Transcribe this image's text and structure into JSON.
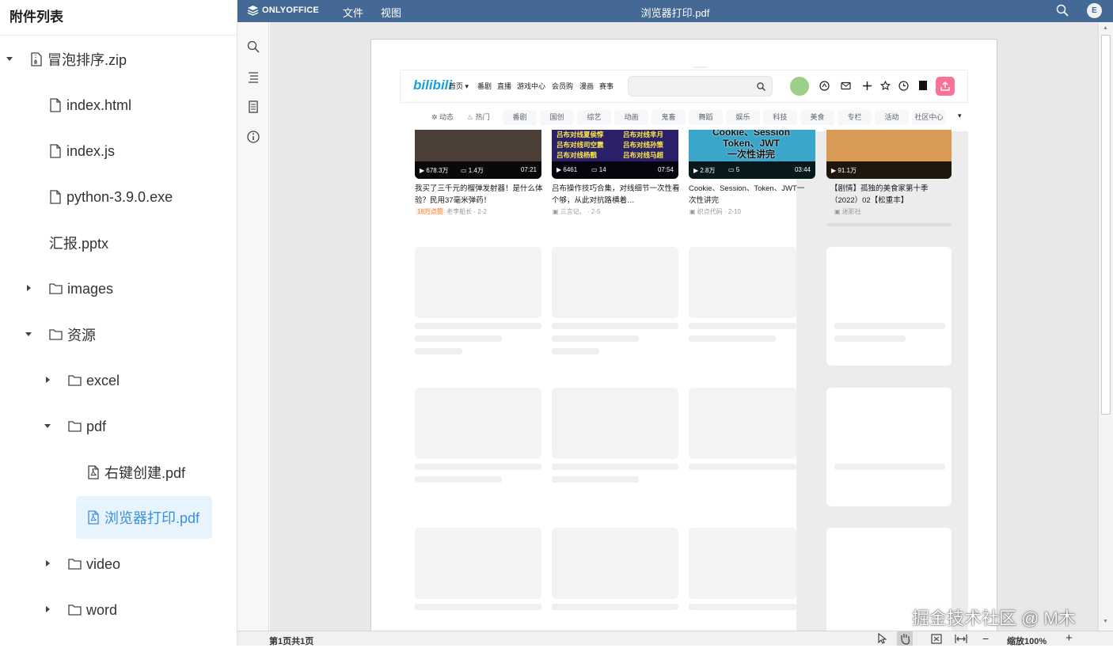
{
  "sidebar": {
    "title": "附件列表",
    "items": [
      {
        "label": "冒泡排序.zip"
      },
      {
        "label": "index.html"
      },
      {
        "label": "index.js"
      },
      {
        "label": "python-3.9.0.exe"
      },
      {
        "label": "汇报.pptx"
      },
      {
        "label": "images"
      },
      {
        "label": "资源"
      },
      {
        "label": "excel"
      },
      {
        "label": "pdf"
      },
      {
        "label": "右键创建.pdf"
      },
      {
        "label": "浏览器打印.pdf"
      },
      {
        "label": "video"
      },
      {
        "label": "word"
      }
    ]
  },
  "editor": {
    "brand": "ONLYOFFICE",
    "menu": [
      "文件",
      "视图"
    ],
    "doc_title": "浏览器打印.pdf",
    "user_initial": "E"
  },
  "statusbar": {
    "page_info": "第1页共1页",
    "zoom": "缩放100%"
  },
  "watermark": "掘金技术社区 @ M木",
  "page": {
    "bili_logo": "bilibili",
    "nav": [
      "首页",
      "番剧",
      "直播",
      "游戏中心",
      "会员购",
      "漫画",
      "赛事"
    ],
    "channels_primary": [
      "动态",
      "热门"
    ],
    "channels": [
      "番剧",
      "国创",
      "综艺",
      "动画",
      "鬼畜",
      "舞蹈",
      "娱乐",
      "科技",
      "美食",
      "专栏",
      "活动",
      "社区中心"
    ],
    "videos": [
      {
        "views": "678.3万",
        "danmaku": "1.4万",
        "duration": "07:21",
        "title": "我买了三千元的榴弹发射器！是什么体验？民用37毫米弹药！",
        "badge": "18万点赞",
        "author": "老李船长",
        "date": "2-2"
      },
      {
        "views": "6461",
        "danmaku": "14",
        "duration": "07:54",
        "title": "吕布操作技巧合集，对线细节一次性看个够，从此对抗路横着…",
        "badge": "",
        "author": "三言记、",
        "date": "2-5"
      },
      {
        "views": "2.8万",
        "danmaku": "5",
        "duration": "03:44",
        "title": "Cookie、Session、Token、JWT一次性讲完",
        "badge": "",
        "author": "织点代码",
        "date": "2-10"
      },
      {
        "views": "91.1万",
        "danmaku": "",
        "duration": "",
        "title": "【剧情】孤独的美食家第十季（2022）02【松重丰】",
        "badge": "",
        "author": "迷影社",
        "date": ""
      }
    ],
    "thumb_text_1": [
      "吕布对线夏侯惇",
      "吕布对线司空震",
      "吕布对线杨戬"
    ],
    "thumb_text_2": [
      "吕布对线芈月",
      "吕布对线孙策",
      "吕布对线马超"
    ],
    "thumb_text_3": [
      "Cookie、Session",
      "Token、JWT",
      "一次性讲完"
    ]
  }
}
